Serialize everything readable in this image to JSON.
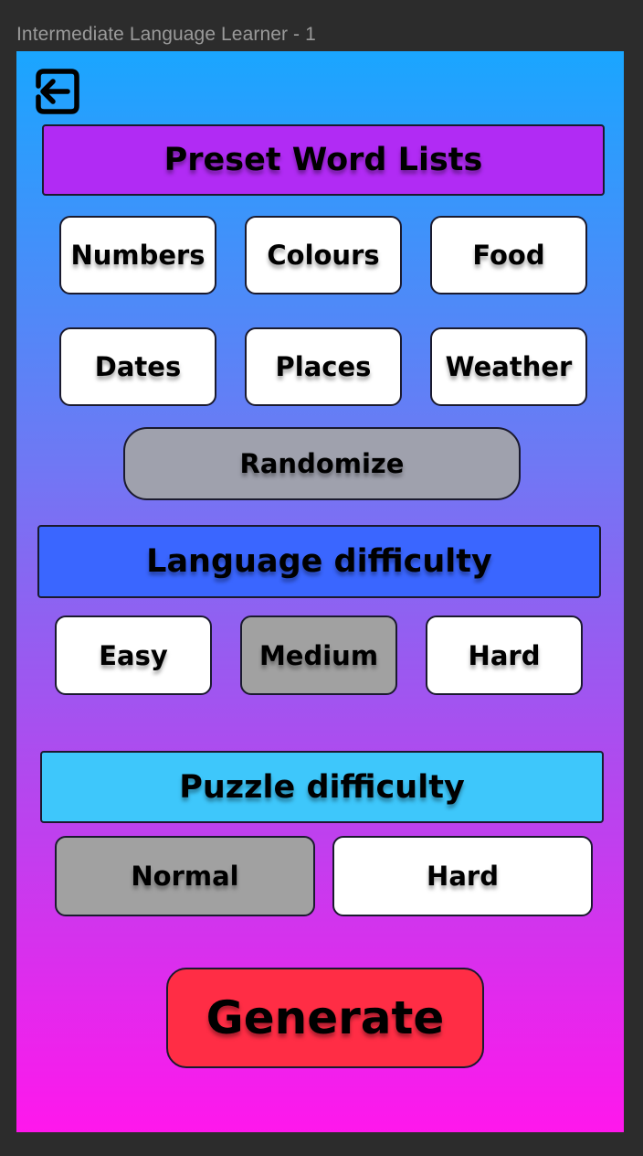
{
  "frame": {
    "title": "Intermediate Language Learner - 1"
  },
  "back_button": {
    "icon": "exit-arrow-icon"
  },
  "preset_section": {
    "title": "Preset Word Lists",
    "color": "#b12bf4",
    "items": [
      {
        "label": "Numbers"
      },
      {
        "label": "Colours"
      },
      {
        "label": "Food"
      },
      {
        "label": "Dates"
      },
      {
        "label": "Places"
      },
      {
        "label": "Weather"
      }
    ],
    "randomize_label": "Randomize"
  },
  "language_section": {
    "title": "Language difficulty",
    "color": "#3a66ff",
    "options": [
      {
        "label": "Easy",
        "selected": false
      },
      {
        "label": "Medium",
        "selected": true
      },
      {
        "label": "Hard",
        "selected": false
      }
    ]
  },
  "puzzle_section": {
    "title": "Puzzle difficulty",
    "color": "#3ec7fb",
    "options": [
      {
        "label": "Normal",
        "selected": true
      },
      {
        "label": "Hard",
        "selected": false
      }
    ]
  },
  "generate": {
    "label": "Generate",
    "color": "#ff2d45"
  }
}
